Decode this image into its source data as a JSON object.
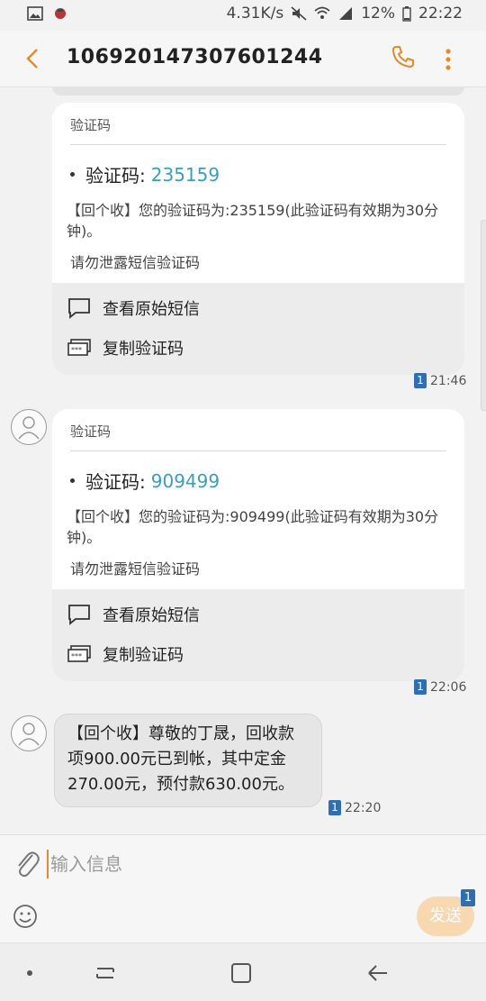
{
  "status": {
    "net_speed": "4.31K/s",
    "battery": "12%",
    "time": "22:22"
  },
  "header": {
    "title": "106920147307601244"
  },
  "cards": [
    {
      "title": "验证码",
      "code_label": "验证码:",
      "code_value": "235159",
      "message": "【回个收】您的验证码为:235159(此验证码有效期为30分钟)。",
      "warning": "请勿泄露短信验证码",
      "action_view": "查看原始短信",
      "action_copy": "复制验证码",
      "sim": "1",
      "time": "21:46"
    },
    {
      "title": "验证码",
      "code_label": "验证码:",
      "code_value": "909499",
      "message": "【回个收】您的验证码为:909499(此验证码有效期为30分钟)。",
      "warning": "请勿泄露短信验证码",
      "action_view": "查看原始短信",
      "action_copy": "复制验证码",
      "sim": "1",
      "time": "22:06"
    }
  ],
  "message": {
    "text": "【回个收】尊敬的丁晟，回收款项900.00元已到帐，其中定金270.00元，预付款630.00元。",
    "sim": "1",
    "time": "22:20"
  },
  "composer": {
    "placeholder": "输入信息",
    "send_label": "发送",
    "send_sim": "1"
  },
  "colors": {
    "accent": "#e38b2c",
    "code": "#3a9fb7",
    "sim": "#2f6fb0"
  }
}
